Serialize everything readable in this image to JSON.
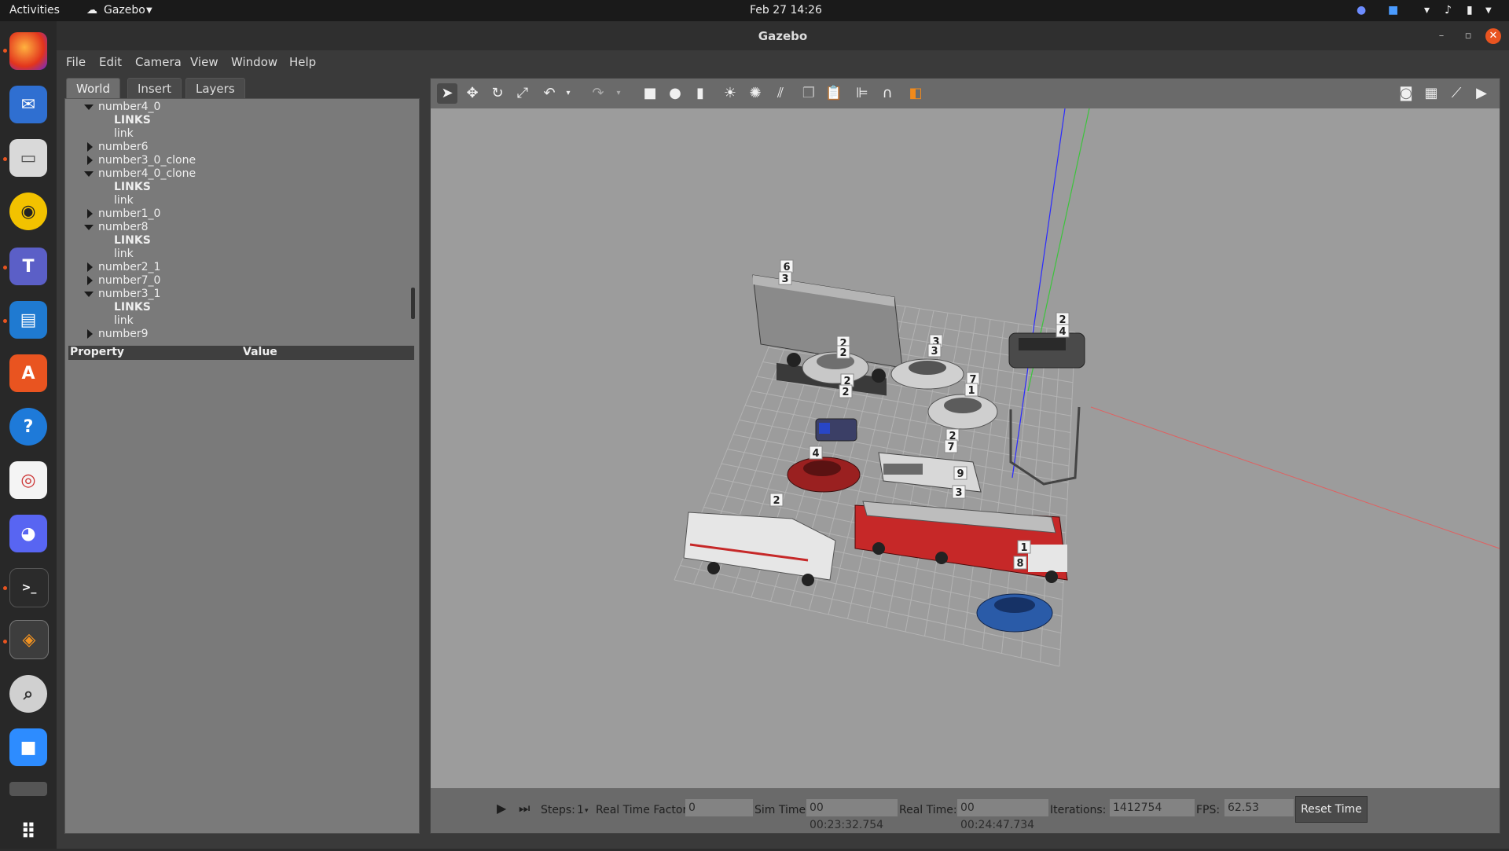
{
  "topbar": {
    "activities": "Activities",
    "app_menu": "Gazebo",
    "datetime": "Feb 27  14:26"
  },
  "window": {
    "title": "Gazebo"
  },
  "menubar": {
    "items": [
      "File",
      "Edit",
      "Camera",
      "View",
      "Window",
      "Help"
    ]
  },
  "leftpanel": {
    "tabs": [
      "World",
      "Insert",
      "Layers"
    ],
    "active_tab": "World",
    "tree": [
      {
        "label": "number4_0",
        "expanded": true
      },
      {
        "label": "LINKS",
        "child": true,
        "bold": true
      },
      {
        "label": "link",
        "child": true
      },
      {
        "label": "number6",
        "expanded": false
      },
      {
        "label": "number3_0_clone",
        "expanded": false
      },
      {
        "label": "number4_0_clone",
        "expanded": true
      },
      {
        "label": "LINKS",
        "child": true,
        "bold": true
      },
      {
        "label": "link",
        "child": true
      },
      {
        "label": "number1_0",
        "expanded": false
      },
      {
        "label": "number8",
        "expanded": true
      },
      {
        "label": "LINKS",
        "child": true,
        "bold": true
      },
      {
        "label": "link",
        "child": true
      },
      {
        "label": "number2_1",
        "expanded": false
      },
      {
        "label": "number7_0",
        "expanded": false
      },
      {
        "label": "number3_1",
        "expanded": true
      },
      {
        "label": "LINKS",
        "child": true,
        "bold": true
      },
      {
        "label": "link",
        "child": true
      },
      {
        "label": "number9",
        "expanded": false
      }
    ],
    "property_header": "Property",
    "value_header": "Value"
  },
  "toolbar": {
    "icons": [
      "select-arrow-icon",
      "translate-icon",
      "rotate-icon",
      "scale-icon",
      "undo-icon",
      "undo-dropdown-icon",
      "redo-icon",
      "redo-dropdown-icon",
      "box-shape-icon",
      "sphere-shape-icon",
      "cylinder-shape-icon",
      "point-light-icon",
      "spot-light-icon",
      "directional-light-icon",
      "copy-icon",
      "paste-icon",
      "align-icon",
      "snap-magnet-icon",
      "view-angle-icon",
      "screenshot-icon",
      "log-icon",
      "plot-icon",
      "record-video-icon"
    ]
  },
  "scene": {
    "model_tags": [
      "6",
      "3",
      "2",
      "2",
      "3",
      "3",
      "2",
      "4",
      "7",
      "1",
      "2",
      "2",
      "2",
      "7",
      "9",
      "3",
      "1",
      "8",
      "4",
      "2"
    ]
  },
  "bottombar": {
    "steps_label": "Steps:",
    "steps_value": "1",
    "rtf_label": "Real Time Factor:",
    "rtf_value": "0",
    "sim_time_label": "Sim Time:",
    "sim_time_value": "00 00:23:32.754",
    "real_time_label": "Real Time:",
    "real_time_value": "00 00:24:47.734",
    "iterations_label": "Iterations:",
    "iterations_value": "1412754",
    "fps_label": "FPS:",
    "fps_value": "62.53",
    "reset_time": "Reset Time"
  },
  "colors": {
    "accent": "#e95420",
    "scene_bg": "#9c9c9c",
    "grid": "#b8b8b8"
  }
}
